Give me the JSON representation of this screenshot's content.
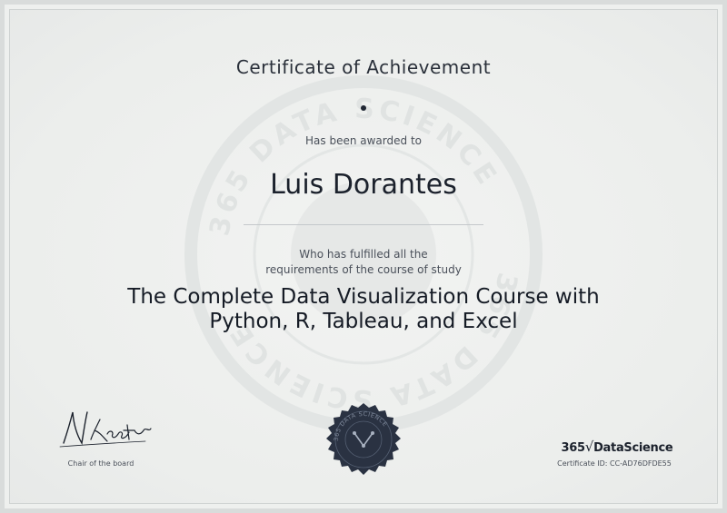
{
  "certificate": {
    "title": "Certificate of Achievement",
    "awarded_label": "Has been awarded to",
    "recipient_name": "Luis Dorantes",
    "fulfilled_line1": "Who has fulfilled all the",
    "fulfilled_line2": "requirements of the course of study",
    "course_title": "The Complete Data Visualization Course with Python, R, Tableau, and Excel"
  },
  "footer": {
    "signer_role": "Chair of the board",
    "signature_text": "N.Krastev",
    "logo_number": "365",
    "logo_radical": "√",
    "logo_name": "DataScience",
    "certificate_id": "Certificate ID: CC-AD76DFDE55"
  },
  "watermark": {
    "text": "365 DATA SCIENCE"
  },
  "seal": {
    "text": "365 DATA SCIENCE"
  },
  "colors": {
    "ink": "#1b212c",
    "seal": "#2a3242",
    "background": "#eceeec"
  }
}
